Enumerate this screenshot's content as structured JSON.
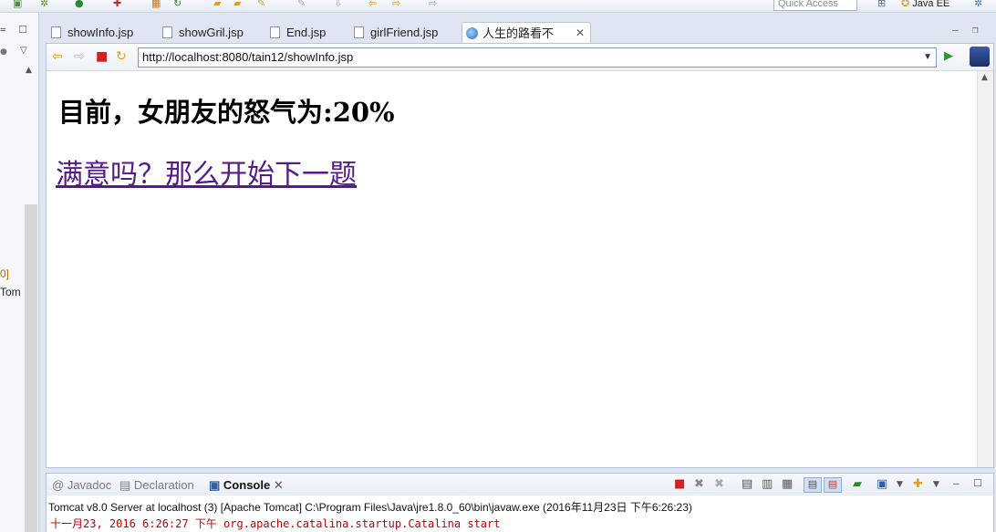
{
  "window": {
    "quick_access_placeholder": "Quick Access",
    "perspective": "Java EE"
  },
  "left_pane": {
    "fragments": [
      "0]",
      "Tom"
    ]
  },
  "editor": {
    "tabs": [
      {
        "label": "showInfo.jsp"
      },
      {
        "label": "showGril.jsp"
      },
      {
        "label": "End.jsp"
      },
      {
        "label": "girlFriend.jsp"
      },
      {
        "label": "人生的路看不清..."
      }
    ],
    "active_tab": 4,
    "close_glyph": "✕"
  },
  "browser": {
    "url": "http://localhost:8080/tain12/showInfo.jsp",
    "heading": "目前，女朋友的怒气为:20%",
    "link": "满意吗？那么开始下一题"
  },
  "console": {
    "tabs": [
      {
        "label": "Javadoc",
        "icon": "at-icon"
      },
      {
        "label": "Declaration",
        "icon": "declaration-icon"
      },
      {
        "label": "Console",
        "icon": "console-icon"
      }
    ],
    "active_tab": 2,
    "status": "Tomcat v8.0 Server at localhost (3) [Apache Tomcat] C:\\Program Files\\Java\\jre1.8.0_60\\bin\\javaw.exe (2016年11月23日 下午6:26:23)",
    "log_line": "十一月23, 2016 6:26:27 下午 org.apache.catalina.startup.Catalina start"
  },
  "colors": {
    "visited_link": "#551a8b",
    "log_text": "#c00000",
    "chrome_bg": "#dfe6f1"
  }
}
